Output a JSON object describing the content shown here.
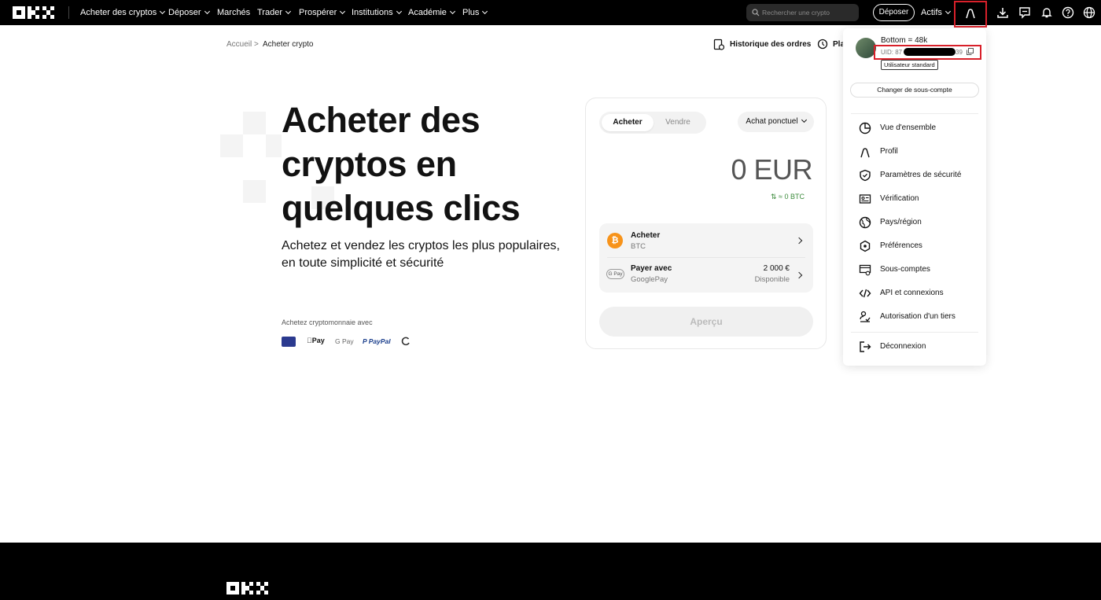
{
  "nav": {
    "items": [
      {
        "label": "Acheter des cryptos",
        "chevron": true
      },
      {
        "label": "Déposer",
        "chevron": true
      },
      {
        "label": "Marchés",
        "chevron": false
      },
      {
        "label": "Trader",
        "chevron": true
      },
      {
        "label": "Prospérer",
        "chevron": true
      },
      {
        "label": "Institutions",
        "chevron": true
      },
      {
        "label": "Académie",
        "chevron": true
      },
      {
        "label": "Plus",
        "chevron": true
      }
    ],
    "search_placeholder": "Rechercher une crypto",
    "deposit_button": "Déposer",
    "assets_label": "Actifs"
  },
  "breadcrumb": {
    "home": "Accueil",
    "separator": ">",
    "current": "Acheter crypto"
  },
  "header_links": {
    "orders_history": "Historique des ordres",
    "plans": "Pla"
  },
  "hero": {
    "title_lines": [
      "Acheter des",
      "cryptos en",
      "quelques clics"
    ],
    "subtitle_lines": [
      "Achetez et vendez les cryptos les plus populaires,",
      "en toute simplicité et sécurité"
    ],
    "payment_caption": "Achetez cryptomonnaie avec",
    "payment_methods": [
      "SEPA",
      "Apple Pay",
      "G Pay",
      "PayPal",
      "other"
    ]
  },
  "trade_card": {
    "tab_buy": "Acheter",
    "tab_sell": "Vendre",
    "order_type": "Achat ponctuel",
    "amount": "0 EUR",
    "conversion": "⇅ ≈ 0 BTC",
    "buy_row": {
      "title": "Acheter",
      "asset": "BTC"
    },
    "pay_row": {
      "title": "Payer avec",
      "method": "GooglePay",
      "amount": "2 000 €",
      "status": "Disponible"
    },
    "preview_button": "Aperçu"
  },
  "account_menu": {
    "user_name": "Bottom = 48k",
    "uid_prefix": "UID: 87",
    "uid_suffix": "39",
    "badge": "Utilisateur standard",
    "switch_subaccount": "Changer de sous-compte",
    "items": [
      {
        "label": "Vue d'ensemble",
        "icon": "pie-chart-icon"
      },
      {
        "label": "Profil",
        "icon": "user-icon"
      },
      {
        "label": "Paramètres de sécurité",
        "icon": "shield-icon"
      },
      {
        "label": "Vérification",
        "icon": "id-card-icon"
      },
      {
        "label": "Pays/région",
        "icon": "globe-icon"
      },
      {
        "label": "Préférences",
        "icon": "settings-icon"
      },
      {
        "label": "Sous-comptes",
        "icon": "sub-accounts-icon"
      },
      {
        "label": "API et connexions",
        "icon": "code-icon"
      },
      {
        "label": "Autorisation d'un tiers",
        "icon": "third-party-icon"
      }
    ],
    "logout": "Déconnexion"
  },
  "colors": {
    "accent": "#000000",
    "highlight": "#d8202a",
    "btc": "#f7931a",
    "positive": "#3a8a3a"
  }
}
